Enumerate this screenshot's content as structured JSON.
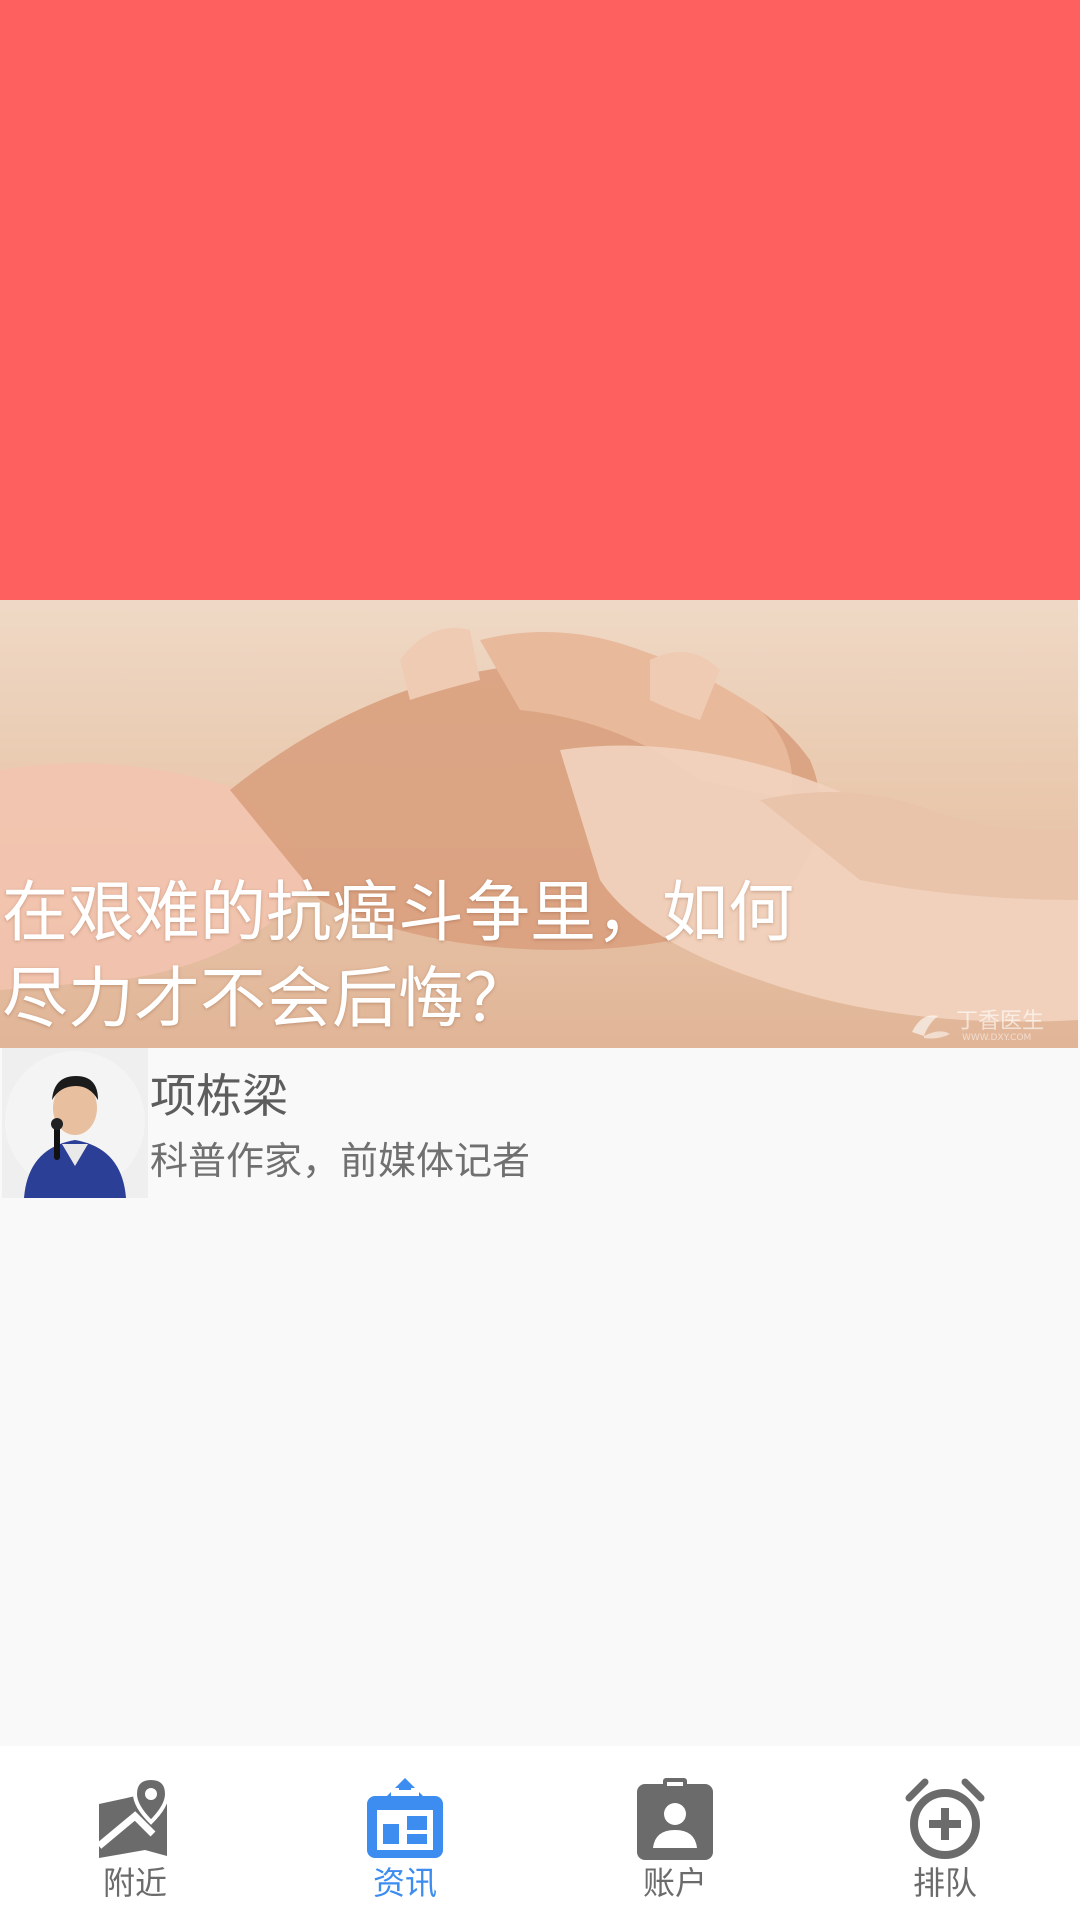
{
  "article": {
    "title_line1": "在艰难的抗癌斗争里，如何",
    "title_line2": "尽力才不会后悔？",
    "watermark": "丁香医生"
  },
  "author": {
    "name": "项栋梁",
    "bio": "科普作家，前媒体记者"
  },
  "tabbar": {
    "items": [
      {
        "label": "附近",
        "icon": "map-pin-icon",
        "active": false
      },
      {
        "label": "资讯",
        "icon": "news-icon",
        "active": true
      },
      {
        "label": "账户",
        "icon": "account-badge-icon",
        "active": false
      },
      {
        "label": "排队",
        "icon": "alarm-add-icon",
        "active": false
      }
    ],
    "colors": {
      "active": "#3d8cf0",
      "inactive": "#6b6b6b"
    }
  },
  "colors": {
    "banner": "#fe6060"
  }
}
